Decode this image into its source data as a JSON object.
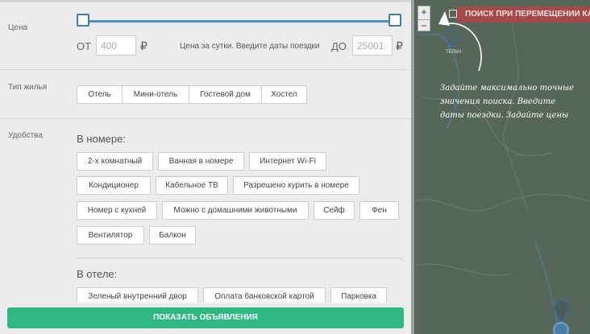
{
  "price": {
    "label": "Цена",
    "from_label": "ОТ",
    "from_value": "400",
    "to_label": "ДО",
    "to_value": "25001",
    "currency": "₽",
    "note": "Цена за сутки. Введите даты поездки"
  },
  "housing": {
    "label": "Тип жилья",
    "options": [
      "Отель",
      "Мини-отель",
      "Гостевой дом",
      "Хостел"
    ]
  },
  "amenities": {
    "label": "Удобства",
    "room": {
      "title": "В номере:",
      "options": [
        "2-х комнатный",
        "Ванная в номере",
        "Интернет Wi-Fi",
        "Кондиционер",
        "Кабельное ТВ",
        "Разрешено курить в номере",
        "Номер с кухней",
        "Можно с домашними животными",
        "Сейф",
        "Фен",
        "Вентилятор",
        "Балкон"
      ]
    },
    "hotel": {
      "title": "В отеле:",
      "options": [
        "Зеленый внутренний двор",
        "Оплата банковской картой",
        "Парковка"
      ]
    }
  },
  "actions": {
    "show_listings": "ПОКАЗАТЬ ОБЪЯВЛЕНИЯ"
  },
  "map": {
    "zoom_in": "+",
    "zoom_out": "−",
    "search_on_move": "ПОИСК ПРИ ПЕРЕМЕЩЕНИИ КАРТЫ",
    "town": "ТЕЛЬЧ",
    "hint": "Задайте максимально точные значения поиска. Введите даты поездки. Задайте цены"
  },
  "colors": {
    "accent_blue": "#4e91bf",
    "show_button": "#2fb883",
    "map_search": "#a54a4a",
    "map_background": "#566759"
  }
}
